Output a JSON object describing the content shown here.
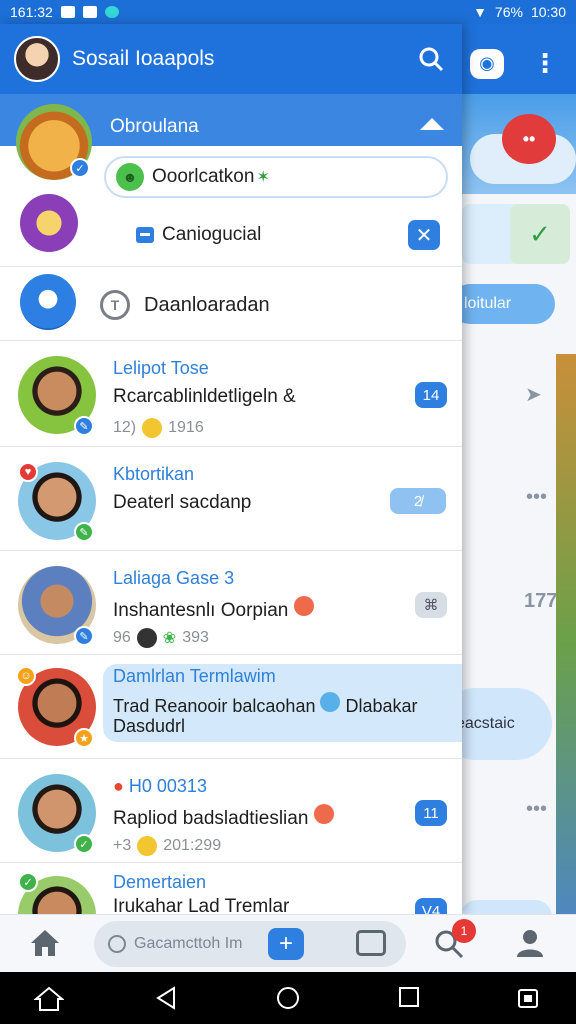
{
  "status_bar": {
    "time_left": "161:32",
    "battery": "76%",
    "time_right": "10:30"
  },
  "header": {
    "title": "Sosail Ioaapols"
  },
  "section": {
    "title": "Obroulana"
  },
  "entry_chip": {
    "text": "Ooorlcatkon"
  },
  "entry_line": {
    "text": "Caniogucial"
  },
  "entry_three": {
    "text": "Daanloaradan"
  },
  "background": {
    "pill_text": "loitular",
    "bubble_text": "eacstaic"
  },
  "chats": [
    {
      "name": "Lelipot Tose",
      "message": "Rcarcablinldetligeln &",
      "meta_left": "12)",
      "meta_right": "1916",
      "count": "14",
      "count_style": "blue",
      "badge": "blue"
    },
    {
      "name": "Kbtortikan",
      "message": "Deaterl sacdanp",
      "meta_left": "",
      "meta_right": "",
      "count": "2̸",
      "count_style": "blue",
      "badge": "green"
    },
    {
      "name": "Laliaga Gase 3",
      "message": "Inshantesnlı Oorpian",
      "meta_left": "96",
      "meta_right": "393",
      "count": "⌘",
      "count_style": "gray",
      "badge": "blue"
    },
    {
      "name": "Damlrlan Termlawim",
      "message": "Trad Reanooir balcaohan",
      "message2": "Dasdudrl",
      "extra": "Dlabakar",
      "count": "",
      "count_style": "",
      "badge": "orange"
    },
    {
      "name": "H0 00313",
      "message": "Rapliod badsladtieslian",
      "meta_left": "+3",
      "meta_right": "201:299",
      "count": "11",
      "count_style": "blue",
      "badge": "green"
    },
    {
      "name": "Demertaien",
      "message": "Irukahar Lad Tremlar",
      "count": "V4",
      "count_style": "blue",
      "badge": "green"
    }
  ],
  "bottom_nav": {
    "search_placeholder": "Gacamcttoh Im",
    "notif_count": "1"
  },
  "colors": {
    "primary": "#1f72db",
    "accent": "#2f7fe0",
    "highlight": "#d3e9fb"
  }
}
